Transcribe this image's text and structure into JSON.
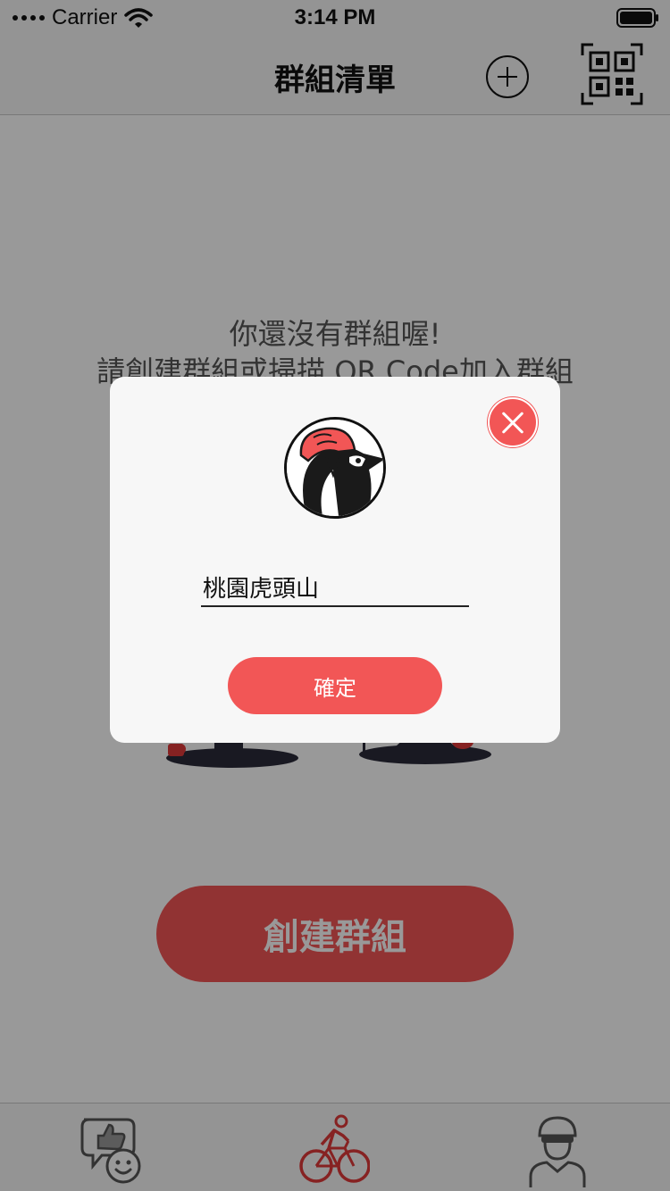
{
  "status_bar": {
    "carrier": "Carrier",
    "time": "3:14 PM"
  },
  "nav": {
    "title": "群組清單",
    "add_icon": "plus-circle-icon",
    "scan_icon": "qr-code-scan-icon"
  },
  "empty_state": {
    "line1": "你還沒有群組喔!",
    "line2": "請創建群組或掃描 QR Code加入群組"
  },
  "create_button": {
    "label": "創建群組"
  },
  "tabs": [
    {
      "name": "feedback",
      "icon": "thumbs-up-smile-icon"
    },
    {
      "name": "ride",
      "icon": "cyclist-icon",
      "active": true
    },
    {
      "name": "profile",
      "icon": "rider-helmet-icon"
    }
  ],
  "modal": {
    "group_name_value": "桃園虎頭山",
    "confirm_label": "確定"
  },
  "colors": {
    "accent": "#f25656",
    "overlay": "rgba(0,0,0,0.40)",
    "bar_background": "#f7f7f7"
  }
}
